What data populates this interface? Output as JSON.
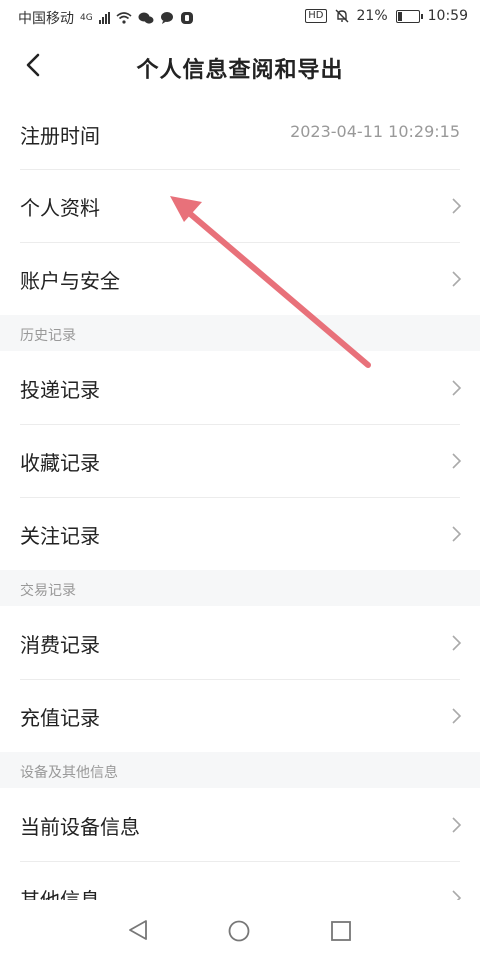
{
  "status_bar": {
    "carrier": "中国移动",
    "network": "4G",
    "hd": "HD",
    "battery_percent": "21%",
    "battery_level": 0.21,
    "time": "10:59"
  },
  "header": {
    "title": "个人信息查阅和导出"
  },
  "rows": {
    "register_time": {
      "label": "注册时间",
      "value": "2023-04-11 10:29:15"
    },
    "personal_profile": {
      "label": "个人资料"
    },
    "account_security": {
      "label": "账户与安全"
    },
    "delivery_records": {
      "label": "投递记录"
    },
    "favorite_records": {
      "label": "收藏记录"
    },
    "follow_records": {
      "label": "关注记录"
    },
    "consumption_records": {
      "label": "消费记录"
    },
    "recharge_records": {
      "label": "充值记录"
    },
    "current_device_info": {
      "label": "当前设备信息"
    },
    "other_info": {
      "label": "其他信息"
    }
  },
  "sections": {
    "history": "历史记录",
    "transactions": "交易记录",
    "device_other": "设备及其他信息"
  },
  "colors": {
    "annotation_arrow": "#e8717a",
    "section_bg": "#f6f7f8",
    "muted_text": "#999999"
  },
  "icons": {
    "back": "chevron-left-icon",
    "row_chevron": "chevron-right-icon"
  }
}
